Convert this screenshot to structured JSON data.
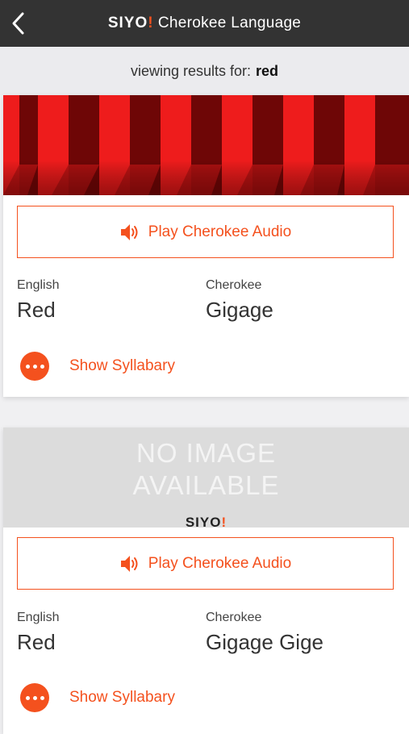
{
  "nav": {
    "brand": "SIYO",
    "brand_bang": "!",
    "title": "Cherokee Language",
    "back_icon": "chevron-left-icon"
  },
  "search": {
    "prefix": "viewing results for:",
    "query": "red"
  },
  "colors": {
    "accent": "#f4511e",
    "nav_bg": "#333333"
  },
  "results": [
    {
      "image": "red-stripes-image",
      "play_label": "Play Cherokee Audio",
      "english_label": "English",
      "english_value": "Red",
      "cherokee_label": "Cherokee",
      "cherokee_value": "Gigage",
      "syllabary_label": "Show Syllabary"
    },
    {
      "image": "no-image-placeholder",
      "no_image_text_1": "NO IMAGE",
      "no_image_text_2": "AVAILABLE",
      "no_image_logo": "SIYO",
      "no_image_logo_bang": "!",
      "play_label": "Play Cherokee Audio",
      "english_label": "English",
      "english_value": "Red",
      "cherokee_label": "Cherokee",
      "cherokee_value": "Gigage Gige",
      "syllabary_label": "Show Syllabary"
    }
  ]
}
